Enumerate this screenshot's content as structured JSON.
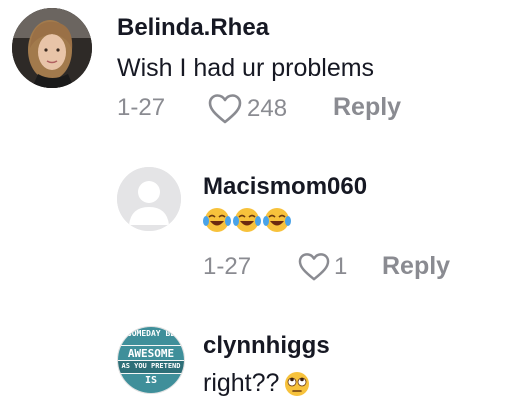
{
  "comments": [
    {
      "username": "Belinda.Rhea",
      "text": "Wish I had ur problems",
      "date": "1-27",
      "likes": "248",
      "reply_label": "Reply",
      "avatar_icon": "user-photo"
    },
    {
      "username": "Macismom060",
      "text": "",
      "emoji": [
        "face-with-tears-of-joy",
        "face-with-tears-of-joy",
        "face-with-tears-of-joy"
      ],
      "date": "1-27",
      "likes": "1",
      "reply_label": "Reply",
      "avatar_icon": "default-avatar"
    },
    {
      "username": "clynnhiggs",
      "text": "right?? ",
      "emoji": [
        "face-with-rolling-eyes"
      ],
      "avatar_badge": [
        "SOMEDAY BE",
        "AWESOME",
        "AS YOU PRETEND",
        "IS"
      ],
      "avatar_icon": "text-badge-avatar"
    }
  ],
  "colors": {
    "text": "#161823",
    "muted": "#8a8b91",
    "badge_teal": "#3f8f9a"
  }
}
